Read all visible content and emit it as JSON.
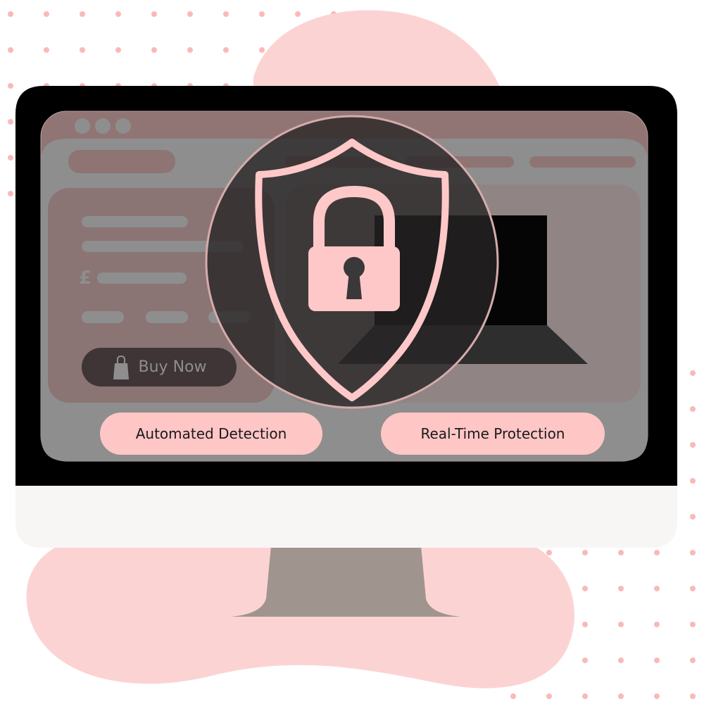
{
  "colors": {
    "blob": "#fcd3d3",
    "dots": "#fab9b9",
    "bezel": "#000000",
    "chin": "#f8f6f4",
    "stand": "#a0958e",
    "accent": "#ffc8c8",
    "window_bar": "#917574",
    "window_body": "#8e8e8e"
  },
  "product_card": {
    "currency_symbol": "£",
    "buy_button": {
      "label": "Buy Now",
      "icon": "shopping-bag-icon"
    }
  },
  "overlay": {
    "icons": [
      "shield-icon",
      "padlock-icon"
    ]
  },
  "features": [
    {
      "label": "Automated Detection"
    },
    {
      "label": "Real-Time Protection"
    }
  ]
}
